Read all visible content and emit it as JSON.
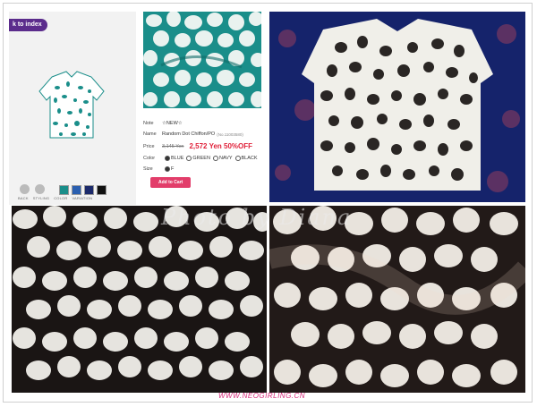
{
  "shop": {
    "back_label": "k to index",
    "thumb_labels": [
      "BACK",
      "STYLING",
      "COLOR",
      "VARIATION"
    ]
  },
  "detail": {
    "note_key": "Note",
    "note_val": "☆NEW☆",
    "name_key": "Name",
    "name_val": "Random Dot Chiffon/PO",
    "name_code": "(No.11003580)",
    "price_key": "Price",
    "price_old": "3,145 Yen",
    "price_new": "2,572 Yen 50%OFF",
    "color_key": "Color",
    "colors": [
      "BLUE",
      "GREEN",
      "NAVY",
      "BLACK"
    ],
    "size_key": "Size",
    "size_val": "F",
    "cart_label": "Add to Cart"
  },
  "watermark": "Photo by Diana",
  "footer_url": "WWW.NEOGIRLING.CN",
  "colors": {
    "teal": "#1a8e8a",
    "navy_bg": "#15236b",
    "sale_red": "#e0213a",
    "cart_pink": "#e23d6a",
    "purple": "#5b2c8c"
  }
}
